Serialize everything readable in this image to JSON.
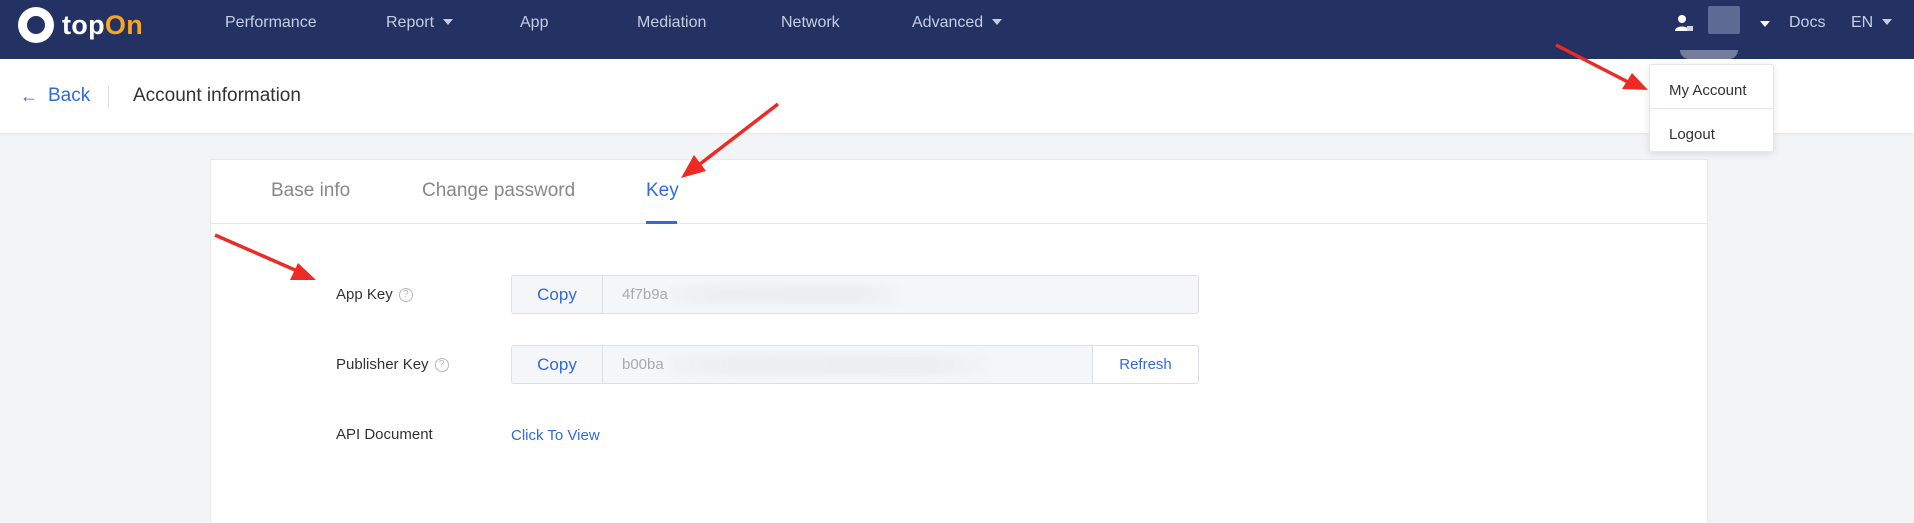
{
  "nav": {
    "logo_prefix": "top",
    "logo_suffix": "On",
    "items": [
      "Performance",
      "Report",
      "App",
      "Mediation",
      "Network",
      "Advanced"
    ],
    "docs": "Docs",
    "language": "EN"
  },
  "subheader": {
    "back": "Back",
    "title": "Account information"
  },
  "tabs": [
    "Base info",
    "Change password",
    "Key"
  ],
  "key": {
    "app_key_label": "App Key",
    "app_key_value": "4f7b9a",
    "publisher_key_label": "Publisher Key",
    "publisher_key_value": "b00ba",
    "api_doc_label": "API Document",
    "api_doc_link": "Click To View",
    "copy": "Copy",
    "refresh": "Refresh",
    "help": "?"
  },
  "account_menu": {
    "my_account": "My Account",
    "logout": "Logout"
  },
  "colors": {
    "nav_bg": "#243263",
    "accent": "#2f6bdb",
    "logo_accent": "#f5a623",
    "annotation": "#ee2a24"
  },
  "icons": {
    "logo": "topon-logo-icon",
    "user": "user-icon",
    "back": "arrow-left-icon",
    "help": "question-circle-icon"
  }
}
